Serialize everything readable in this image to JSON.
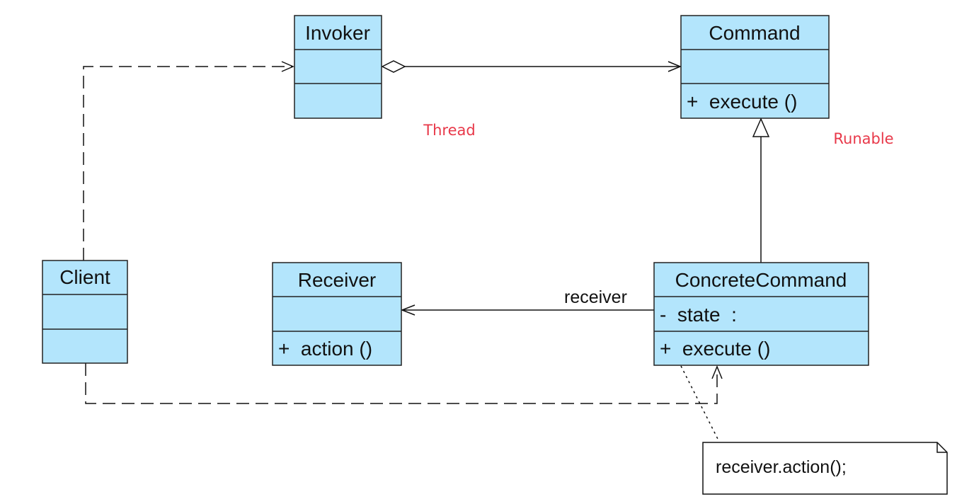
{
  "classes": {
    "invoker": {
      "name": "Invoker"
    },
    "command": {
      "name": "Command",
      "operation": "+  execute ()"
    },
    "client": {
      "name": "Client"
    },
    "receiver": {
      "name": "Receiver",
      "operation": "+  action ()"
    },
    "concrete_command": {
      "name": "ConcreteCommand",
      "attribute": "-  state  :",
      "operation": "+  execute ()"
    }
  },
  "associations": {
    "receiver_label": "receiver"
  },
  "note": {
    "text": "receiver.action();"
  },
  "annotations": {
    "thread": "Thread",
    "runable": "Runable"
  },
  "colors": {
    "class_fill": "#b3e5fc",
    "annotation": "#e8394a"
  }
}
